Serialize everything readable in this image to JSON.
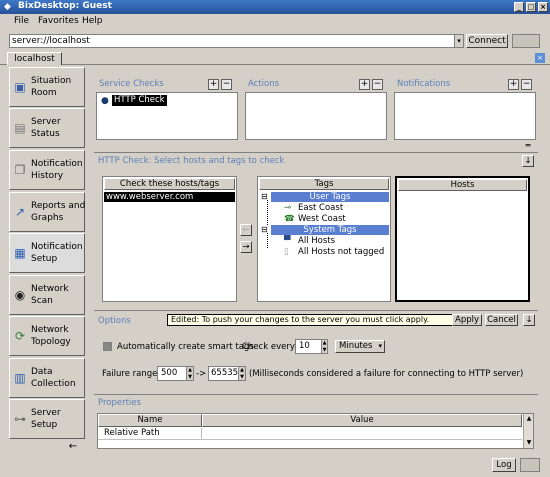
{
  "window": {
    "title": "BixDesktop: Guest"
  },
  "menu": [
    "File",
    "Favorites",
    "Help"
  ],
  "address": {
    "value": "server://localhost",
    "connect_label": "Connect"
  },
  "tab": {
    "label": "localhost"
  },
  "sidebar": {
    "items": [
      {
        "label": "Situation Room",
        "icon": "monitor-icon"
      },
      {
        "label": "Server Status",
        "icon": "server-icon"
      },
      {
        "label": "Notification History",
        "icon": "documents-icon"
      },
      {
        "label": "Reports and Graphs",
        "icon": "graph-icon"
      },
      {
        "label": "Notification Setup",
        "icon": "notification-icon"
      },
      {
        "label": "Network Scan",
        "icon": "eye-icon"
      },
      {
        "label": "Network Topology",
        "icon": "topology-icon"
      },
      {
        "label": "Data Collection",
        "icon": "data-icon"
      },
      {
        "label": "Server Setup",
        "icon": "server-setup-icon"
      }
    ]
  },
  "panels": {
    "service_checks": {
      "title": "Service Checks",
      "items": [
        "HTTP Check"
      ]
    },
    "actions": {
      "title": "Actions"
    },
    "notifications": {
      "title": "Notifications"
    }
  },
  "http_check": {
    "title": "HTTP Check: Select hosts and tags to check",
    "check_header": "Check these hosts/tags",
    "check_items": [
      "www.webserver.com"
    ],
    "tags_header": "Tags",
    "tags": {
      "user_tags": "User Tags",
      "east_coast": "East Coast",
      "west_coast": "West Coast",
      "system_tags": "System Tags",
      "all_hosts": "All Hosts",
      "all_hosts_not_tagged": "All Hosts not tagged"
    },
    "hosts_header": "Hosts"
  },
  "options": {
    "title": "Options",
    "edited_msg": "Edited: To push your changes to the server you must click apply.",
    "apply": "Apply",
    "cancel": "Cancel",
    "auto_smart_tags": "Automatically create smart tags",
    "check_every_label": "Check every",
    "check_every_value": "10",
    "check_every_unit": "Minutes",
    "failure_range_label": "Failure range",
    "failure_min": "500",
    "arrow": "->",
    "failure_max": "65535",
    "failure_note": "(Milliseconds considered a failure for connecting to HTTP server)"
  },
  "properties": {
    "title": "Properties",
    "col_name": "Name",
    "col_value": "Value",
    "rows": [
      "Relative Path"
    ]
  },
  "status": {
    "log": "Log"
  }
}
